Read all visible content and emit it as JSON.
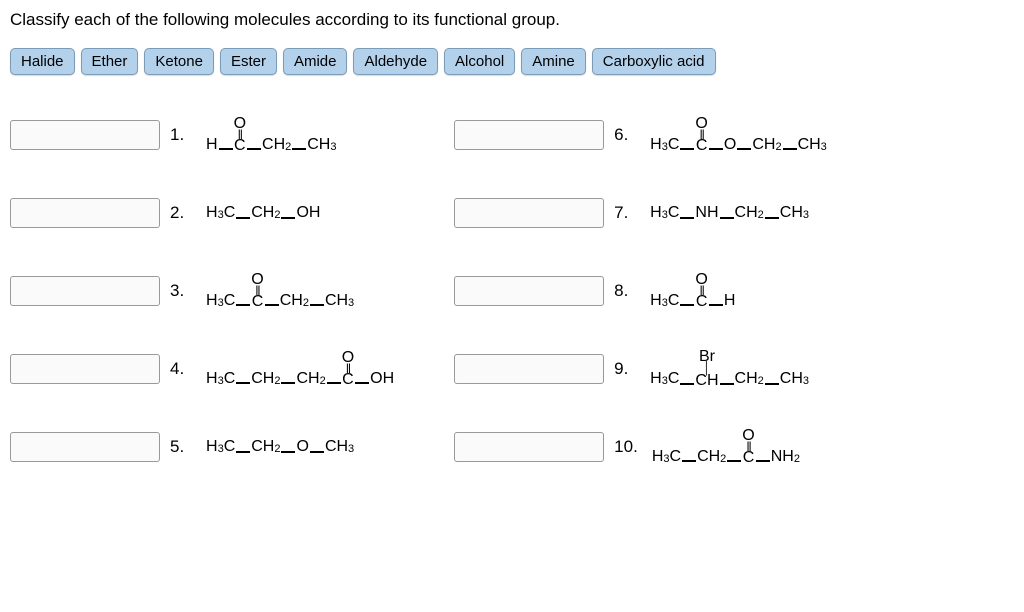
{
  "question": "Classify each of the following molecules according to its functional group.",
  "chips": [
    "Halide",
    "Ether",
    "Ketone",
    "Ester",
    "Amide",
    "Aldehyde",
    "Alcohol",
    "Amine",
    "Carboxylic acid"
  ],
  "items": {
    "left": [
      {
        "num": "1.",
        "type": "carbonyl",
        "pre": "H",
        "post": "CH2—CH3",
        "postSub": [
          2,
          3
        ]
      },
      {
        "num": "2.",
        "type": "plain",
        "text": "H3C—CH2—OH"
      },
      {
        "num": "3.",
        "type": "carbonyl",
        "pre": "H3C",
        "post": "CH2—CH3"
      },
      {
        "num": "4.",
        "type": "carbonyl_end",
        "pre": "H3C—CH2—CH2",
        "post": "OH"
      },
      {
        "num": "5.",
        "type": "plain",
        "text": "H3C—CH2—O—CH3"
      }
    ],
    "right": [
      {
        "num": "6.",
        "type": "carbonyl",
        "pre": "H3C",
        "post": "O—CH2—CH3"
      },
      {
        "num": "7.",
        "type": "plain",
        "text": "H3C—NH—CH2—CH3"
      },
      {
        "num": "8.",
        "type": "carbonyl",
        "pre": "H3C",
        "post": "H"
      },
      {
        "num": "9.",
        "type": "br",
        "pre": "H3C",
        "post": "CH2—CH3"
      },
      {
        "num": "10.",
        "type": "carbonyl_end",
        "pre": "H3C—CH2",
        "post": "NH2"
      }
    ]
  },
  "labels": {
    "O": "O",
    "C": "C",
    "Br": "Br",
    "CH": "CH"
  }
}
